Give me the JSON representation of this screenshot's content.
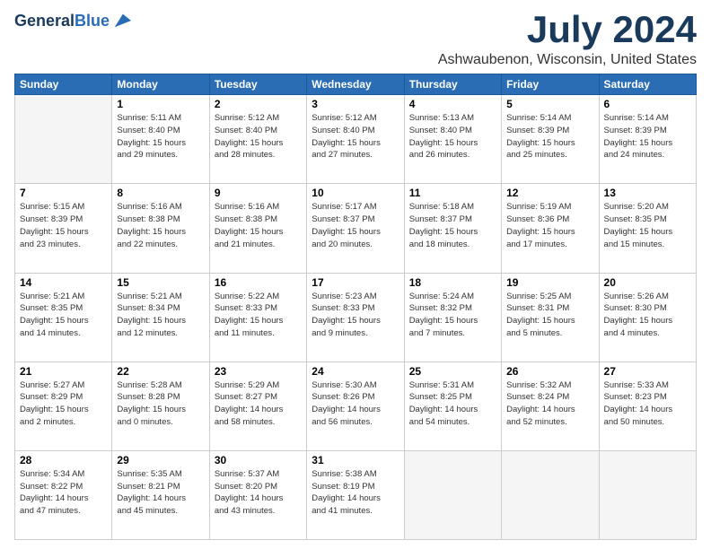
{
  "header": {
    "logo_line1": "General",
    "logo_line2": "Blue",
    "month": "July 2024",
    "location": "Ashwaubenon, Wisconsin, United States"
  },
  "days_of_week": [
    "Sunday",
    "Monday",
    "Tuesday",
    "Wednesday",
    "Thursday",
    "Friday",
    "Saturday"
  ],
  "weeks": [
    [
      {
        "day": "",
        "info": ""
      },
      {
        "day": "1",
        "info": "Sunrise: 5:11 AM\nSunset: 8:40 PM\nDaylight: 15 hours\nand 29 minutes."
      },
      {
        "day": "2",
        "info": "Sunrise: 5:12 AM\nSunset: 8:40 PM\nDaylight: 15 hours\nand 28 minutes."
      },
      {
        "day": "3",
        "info": "Sunrise: 5:12 AM\nSunset: 8:40 PM\nDaylight: 15 hours\nand 27 minutes."
      },
      {
        "day": "4",
        "info": "Sunrise: 5:13 AM\nSunset: 8:40 PM\nDaylight: 15 hours\nand 26 minutes."
      },
      {
        "day": "5",
        "info": "Sunrise: 5:14 AM\nSunset: 8:39 PM\nDaylight: 15 hours\nand 25 minutes."
      },
      {
        "day": "6",
        "info": "Sunrise: 5:14 AM\nSunset: 8:39 PM\nDaylight: 15 hours\nand 24 minutes."
      }
    ],
    [
      {
        "day": "7",
        "info": "Sunrise: 5:15 AM\nSunset: 8:39 PM\nDaylight: 15 hours\nand 23 minutes."
      },
      {
        "day": "8",
        "info": "Sunrise: 5:16 AM\nSunset: 8:38 PM\nDaylight: 15 hours\nand 22 minutes."
      },
      {
        "day": "9",
        "info": "Sunrise: 5:16 AM\nSunset: 8:38 PM\nDaylight: 15 hours\nand 21 minutes."
      },
      {
        "day": "10",
        "info": "Sunrise: 5:17 AM\nSunset: 8:37 PM\nDaylight: 15 hours\nand 20 minutes."
      },
      {
        "day": "11",
        "info": "Sunrise: 5:18 AM\nSunset: 8:37 PM\nDaylight: 15 hours\nand 18 minutes."
      },
      {
        "day": "12",
        "info": "Sunrise: 5:19 AM\nSunset: 8:36 PM\nDaylight: 15 hours\nand 17 minutes."
      },
      {
        "day": "13",
        "info": "Sunrise: 5:20 AM\nSunset: 8:35 PM\nDaylight: 15 hours\nand 15 minutes."
      }
    ],
    [
      {
        "day": "14",
        "info": "Sunrise: 5:21 AM\nSunset: 8:35 PM\nDaylight: 15 hours\nand 14 minutes."
      },
      {
        "day": "15",
        "info": "Sunrise: 5:21 AM\nSunset: 8:34 PM\nDaylight: 15 hours\nand 12 minutes."
      },
      {
        "day": "16",
        "info": "Sunrise: 5:22 AM\nSunset: 8:33 PM\nDaylight: 15 hours\nand 11 minutes."
      },
      {
        "day": "17",
        "info": "Sunrise: 5:23 AM\nSunset: 8:33 PM\nDaylight: 15 hours\nand 9 minutes."
      },
      {
        "day": "18",
        "info": "Sunrise: 5:24 AM\nSunset: 8:32 PM\nDaylight: 15 hours\nand 7 minutes."
      },
      {
        "day": "19",
        "info": "Sunrise: 5:25 AM\nSunset: 8:31 PM\nDaylight: 15 hours\nand 5 minutes."
      },
      {
        "day": "20",
        "info": "Sunrise: 5:26 AM\nSunset: 8:30 PM\nDaylight: 15 hours\nand 4 minutes."
      }
    ],
    [
      {
        "day": "21",
        "info": "Sunrise: 5:27 AM\nSunset: 8:29 PM\nDaylight: 15 hours\nand 2 minutes."
      },
      {
        "day": "22",
        "info": "Sunrise: 5:28 AM\nSunset: 8:28 PM\nDaylight: 15 hours\nand 0 minutes."
      },
      {
        "day": "23",
        "info": "Sunrise: 5:29 AM\nSunset: 8:27 PM\nDaylight: 14 hours\nand 58 minutes."
      },
      {
        "day": "24",
        "info": "Sunrise: 5:30 AM\nSunset: 8:26 PM\nDaylight: 14 hours\nand 56 minutes."
      },
      {
        "day": "25",
        "info": "Sunrise: 5:31 AM\nSunset: 8:25 PM\nDaylight: 14 hours\nand 54 minutes."
      },
      {
        "day": "26",
        "info": "Sunrise: 5:32 AM\nSunset: 8:24 PM\nDaylight: 14 hours\nand 52 minutes."
      },
      {
        "day": "27",
        "info": "Sunrise: 5:33 AM\nSunset: 8:23 PM\nDaylight: 14 hours\nand 50 minutes."
      }
    ],
    [
      {
        "day": "28",
        "info": "Sunrise: 5:34 AM\nSunset: 8:22 PM\nDaylight: 14 hours\nand 47 minutes."
      },
      {
        "day": "29",
        "info": "Sunrise: 5:35 AM\nSunset: 8:21 PM\nDaylight: 14 hours\nand 45 minutes."
      },
      {
        "day": "30",
        "info": "Sunrise: 5:37 AM\nSunset: 8:20 PM\nDaylight: 14 hours\nand 43 minutes."
      },
      {
        "day": "31",
        "info": "Sunrise: 5:38 AM\nSunset: 8:19 PM\nDaylight: 14 hours\nand 41 minutes."
      },
      {
        "day": "",
        "info": ""
      },
      {
        "day": "",
        "info": ""
      },
      {
        "day": "",
        "info": ""
      }
    ]
  ]
}
